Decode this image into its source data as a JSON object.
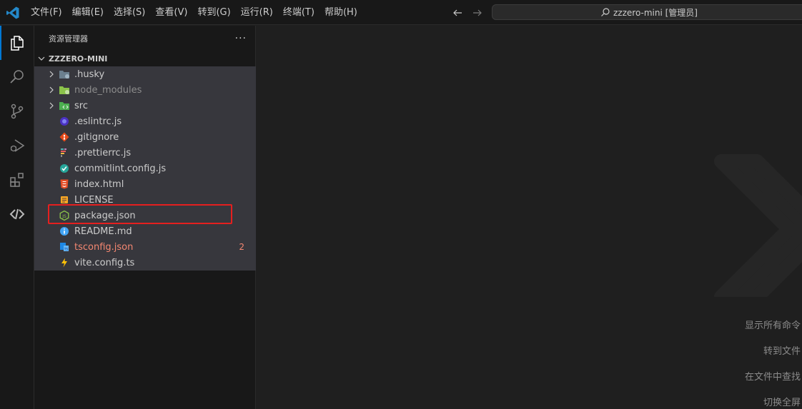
{
  "menu": [
    "文件(F)",
    "编辑(E)",
    "选择(S)",
    "查看(V)",
    "转到(G)",
    "运行(R)",
    "终端(T)",
    "帮助(H)"
  ],
  "command_center": "zzzero-mini [管理员]",
  "sidebar": {
    "title": "资源管理器",
    "more": "···",
    "section": "ZZZERO-MINI",
    "items": [
      {
        "name": ".husky",
        "type": "folder",
        "icon": "husky-folder-icon",
        "color": "#6b7f8e"
      },
      {
        "name": "node_modules",
        "type": "folder",
        "icon": "node-folder-icon",
        "color": "#8bc34a",
        "dim": true
      },
      {
        "name": "src",
        "type": "folder",
        "icon": "src-folder-icon",
        "color": "#4caf50"
      },
      {
        "name": ".eslintrc.js",
        "type": "file",
        "icon": "eslint-icon",
        "color": "#7c7cf0"
      },
      {
        "name": ".gitignore",
        "type": "file",
        "icon": "git-icon",
        "color": "#e64a19"
      },
      {
        "name": ".prettierrc.js",
        "type": "file",
        "icon": "prettier-icon",
        "color": "#8a8a8a"
      },
      {
        "name": "commitlint.config.js",
        "type": "file",
        "icon": "commitlint-icon",
        "color": "#26a69a"
      },
      {
        "name": "index.html",
        "type": "file",
        "icon": "html-icon",
        "color": "#e44d26"
      },
      {
        "name": "LICENSE",
        "type": "file",
        "icon": "license-icon",
        "color": "#f9a825"
      },
      {
        "name": "package.json",
        "type": "file",
        "icon": "nodejs-icon",
        "color": "#8bc34a"
      },
      {
        "name": "README.md",
        "type": "file",
        "icon": "info-icon",
        "color": "#42a5f5"
      },
      {
        "name": "tsconfig.json",
        "type": "file",
        "icon": "tsconfig-icon",
        "color": "#1e88e5",
        "error": true,
        "badge": "2"
      },
      {
        "name": "vite.config.ts",
        "type": "file",
        "icon": "vite-icon",
        "color": "#ffc107"
      }
    ]
  },
  "editor": {
    "shortcuts": [
      "显示所有命令",
      "转到文件",
      "在文件中查找",
      "切换全屏"
    ]
  },
  "colors": {
    "accent": "#0078d4",
    "highlight_box": "#e51f1f",
    "error": "#f48771"
  }
}
